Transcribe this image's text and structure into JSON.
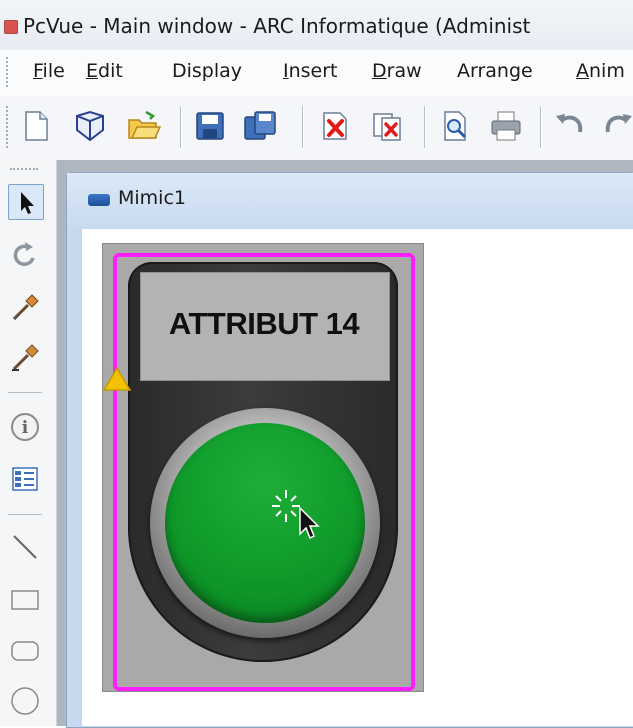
{
  "window": {
    "title": "PcVue - Main window - ARC Informatique (Administ"
  },
  "menu": {
    "items": [
      {
        "label": "File",
        "mnemonic": "F"
      },
      {
        "label": "Edit",
        "mnemonic": "E"
      },
      {
        "label": "Display",
        "mnemonic": "y"
      },
      {
        "label": "Insert",
        "mnemonic": "I"
      },
      {
        "label": "Draw",
        "mnemonic": "D"
      },
      {
        "label": "Arrange",
        "mnemonic": "r"
      },
      {
        "label": "Anim",
        "mnemonic": "A"
      }
    ]
  },
  "toolbar": {
    "buttons": [
      {
        "name": "new-document-icon"
      },
      {
        "name": "3d-view-icon"
      },
      {
        "name": "open-folder-icon"
      },
      {
        "name": "save-icon"
      },
      {
        "name": "save-all-icon"
      },
      {
        "name": "delete-icon"
      },
      {
        "name": "delete-page-icon"
      },
      {
        "name": "print-preview-icon"
      },
      {
        "name": "print-icon"
      },
      {
        "name": "undo-icon"
      },
      {
        "name": "redo-icon"
      }
    ]
  },
  "left_toolbar": {
    "tools": [
      {
        "name": "select-arrow-icon",
        "selected": true
      },
      {
        "name": "rotate-icon",
        "selected": false
      },
      {
        "name": "pipette-icon",
        "selected": false
      },
      {
        "name": "pipette-fill-icon",
        "selected": false
      },
      {
        "name": "info-icon",
        "selected": false
      },
      {
        "name": "properties-icon",
        "selected": false
      },
      {
        "name": "line-tool-icon",
        "selected": false
      },
      {
        "name": "rectangle-tool-icon",
        "selected": false
      },
      {
        "name": "rounded-rectangle-tool-icon",
        "selected": false
      },
      {
        "name": "ellipse-tool-icon",
        "selected": false
      }
    ]
  },
  "document": {
    "title": "Mimic1"
  },
  "symbol": {
    "label": "ATTRIBUT 14",
    "button_color": "#0f9a2a",
    "selection_color": "#ff1fff"
  },
  "colors": {
    "selection": "#ff1fff",
    "button_green": "#0f9a2a",
    "warning_yellow": "#f2c200"
  }
}
